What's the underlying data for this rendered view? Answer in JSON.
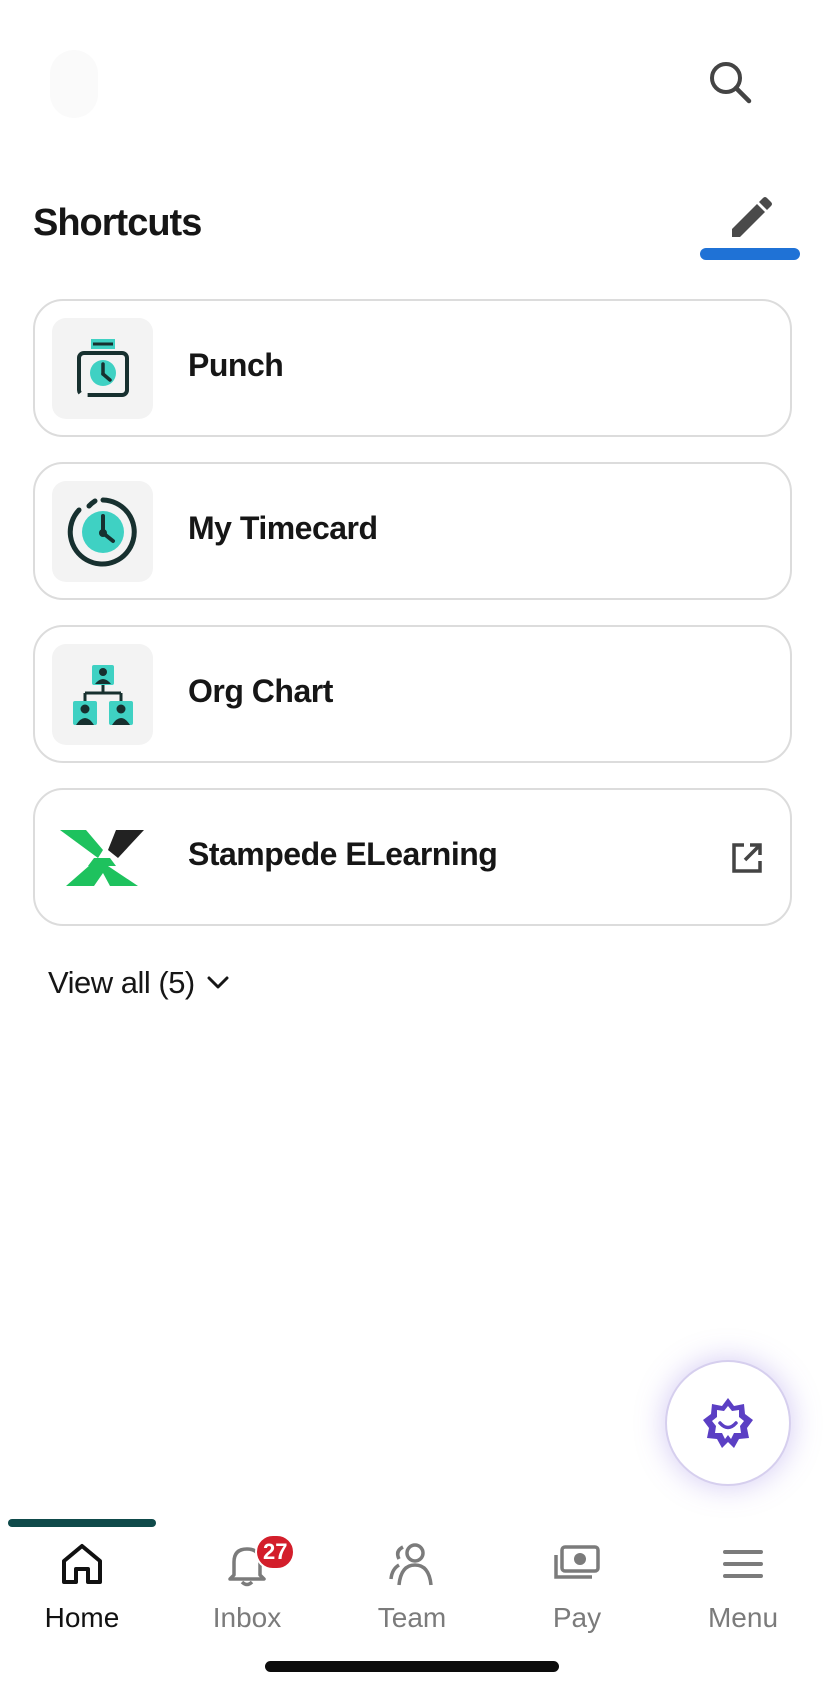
{
  "header": {
    "search_icon": "search-icon"
  },
  "shortcuts": {
    "title": "Shortcuts",
    "edit_icon": "pencil-icon",
    "items": [
      {
        "label": "Punch",
        "icon": "punch-clock-icon"
      },
      {
        "label": "My Timecard",
        "icon": "timecard-clock-icon"
      },
      {
        "label": "Org Chart",
        "icon": "org-chart-icon"
      },
      {
        "label": "Stampede ELearning",
        "icon": "stampede-logo-icon",
        "external": true
      }
    ],
    "view_all": "View all (5)"
  },
  "assistant": {
    "icon": "assistant-smile-badge-icon"
  },
  "bottom_nav": {
    "items": [
      {
        "label": "Home",
        "icon": "home-icon",
        "active": true
      },
      {
        "label": "Inbox",
        "icon": "bell-icon",
        "badge": "27"
      },
      {
        "label": "Team",
        "icon": "team-icon"
      },
      {
        "label": "Pay",
        "icon": "pay-icon"
      },
      {
        "label": "Menu",
        "icon": "menu-icon"
      }
    ]
  },
  "colors": {
    "accent_blue": "#1f72d6",
    "teal": "#3fd1c3",
    "dark_teal": "#0f4a4a",
    "badge_red": "#d31e2b",
    "assistant_purple": "#5b3fc4"
  }
}
